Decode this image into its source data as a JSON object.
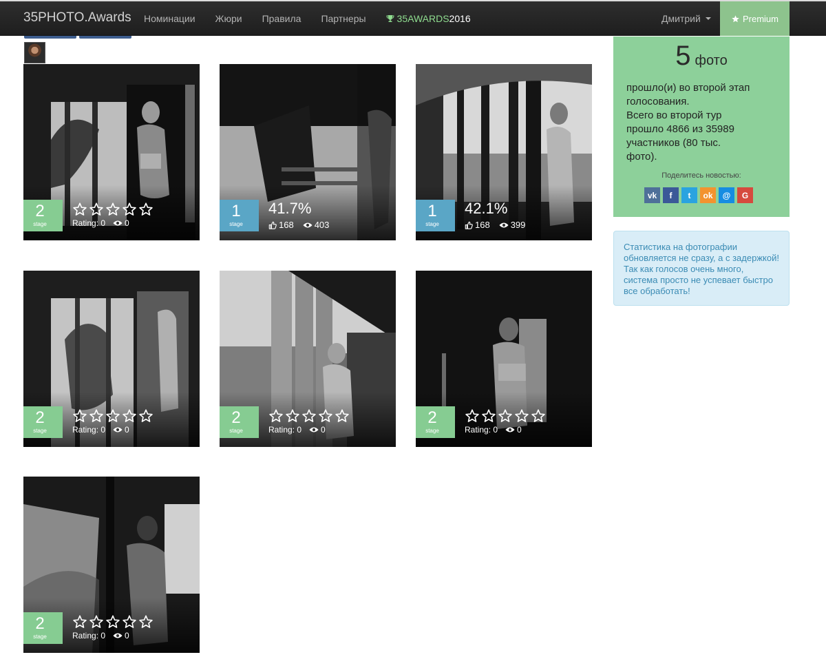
{
  "navbar": {
    "brand": "35PHOTO.Awards",
    "links": [
      "Номинации",
      "Жюри",
      "Правила",
      "Партнеры"
    ],
    "award_label": "35AWARDS",
    "award_year": "2016",
    "user_name": "Дмитрий",
    "premium_label": "Premium"
  },
  "tiles": [
    {
      "stage": "2",
      "stage_word": "stage",
      "mode": "rating",
      "rating": "Rating: 0",
      "views": "0"
    },
    {
      "stage": "1",
      "stage_word": "stage",
      "mode": "percent",
      "percent": "41.7%",
      "likes": "168",
      "views": "403"
    },
    {
      "stage": "1",
      "stage_word": "stage",
      "mode": "percent",
      "percent": "42.1%",
      "likes": "168",
      "views": "399"
    },
    {
      "stage": "2",
      "stage_word": "stage",
      "mode": "rating",
      "rating": "Rating: 0",
      "views": "0"
    },
    {
      "stage": "2",
      "stage_word": "stage",
      "mode": "rating",
      "rating": "Rating: 0",
      "views": "0"
    },
    {
      "stage": "2",
      "stage_word": "stage",
      "mode": "rating",
      "rating": "Rating: 0",
      "views": "0"
    },
    {
      "stage": "2",
      "stage_word": "stage",
      "mode": "rating",
      "rating": "Rating: 0",
      "views": "0"
    }
  ],
  "stats": {
    "count": "5",
    "unit": "фото",
    "lines": [
      "прошло(и) во второй этап",
      "голосования.",
      "Всего во второй тур",
      "прошло 4866 из 35989",
      "участников (80 тыс.",
      "фото)."
    ],
    "share_label": "Поделитесь новостью:",
    "social": [
      {
        "icon": "vk-icon",
        "glyph": "vk",
        "color": "#4e7099"
      },
      {
        "icon": "facebook-icon",
        "glyph": "f",
        "color": "#3b5998"
      },
      {
        "icon": "twitter-icon",
        "glyph": "t",
        "color": "#2aa3e0"
      },
      {
        "icon": "odnoklassniki-icon",
        "glyph": "ok",
        "color": "#f3932f"
      },
      {
        "icon": "mailru-icon",
        "glyph": "@",
        "color": "#168de2"
      },
      {
        "icon": "google-plus-icon",
        "glyph": "G",
        "color": "#d64a3e"
      }
    ]
  },
  "note": {
    "text": "Статистика на фотографии обновляется не сразу, а с задержкой! Так как голосов очень много, система просто не успевает быстро все обработать!"
  },
  "colors": {
    "navbar_bg": "#262626",
    "stage_green": "#86cc92",
    "stage_blue": "#5aa6c6",
    "panel_green": "#8dd09a",
    "premium": "#8dc38d",
    "note_bg": "#d9edf7",
    "note_text": "#3a8bb4"
  }
}
